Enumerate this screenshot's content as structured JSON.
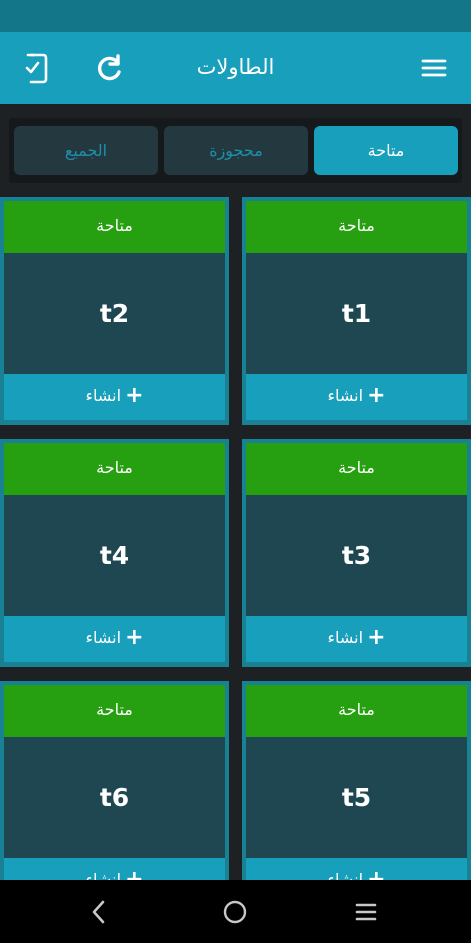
{
  "app_bar": {
    "title": "الطاولات",
    "icons": {
      "menu": "menu-icon",
      "refresh": "refresh-icon",
      "device": "phone-check-icon"
    }
  },
  "tabs": [
    {
      "label": "متاحة",
      "active": true
    },
    {
      "label": "محجوزة",
      "active": false
    },
    {
      "label": "الجميع",
      "active": false
    }
  ],
  "tables": [
    {
      "name": "t1",
      "status": "متاحة",
      "action": "انشاء"
    },
    {
      "name": "t2",
      "status": "متاحة",
      "action": "انشاء"
    },
    {
      "name": "t3",
      "status": "متاحة",
      "action": "انشاء"
    },
    {
      "name": "t4",
      "status": "متاحة",
      "action": "انشاء"
    },
    {
      "name": "t5",
      "status": "متاحة",
      "action": "انشاء"
    },
    {
      "name": "t6",
      "status": "متاحة",
      "action": "انشاء"
    }
  ],
  "colors": {
    "primary": "#189fbb",
    "available": "#26a010",
    "card_body": "#1f4751"
  },
  "nav": {
    "back": "back-icon",
    "home": "home-icon",
    "recents": "recents-icon"
  }
}
